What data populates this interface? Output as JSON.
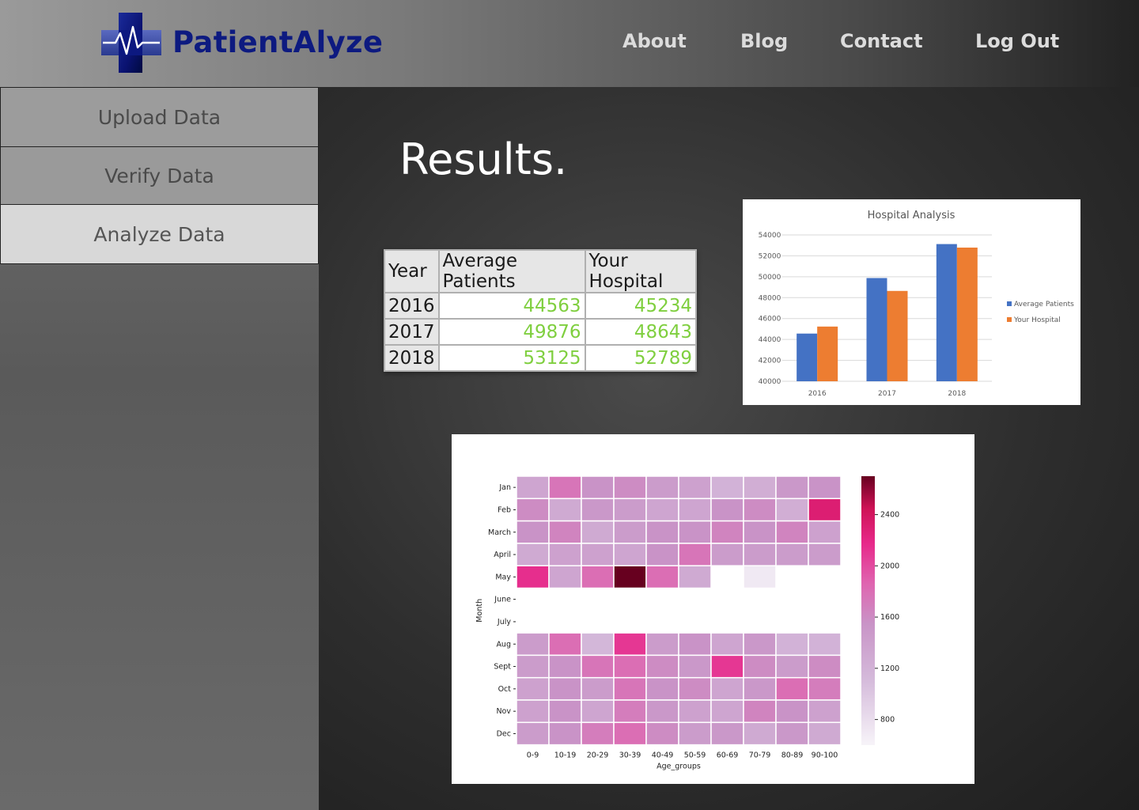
{
  "header": {
    "brand": "PatientAlyze",
    "nav": [
      {
        "label": "About"
      },
      {
        "label": "Blog"
      },
      {
        "label": "Contact"
      },
      {
        "label": "Log Out"
      }
    ]
  },
  "sidebar": {
    "items": [
      {
        "label": "Upload Data"
      },
      {
        "label": "Verify Data"
      },
      {
        "label": "Analyze Data",
        "active": true
      }
    ]
  },
  "main": {
    "title": "Results."
  },
  "table": {
    "headers": [
      "Year",
      "Average Patients",
      "Your Hospital"
    ],
    "rows": [
      {
        "year": "2016",
        "average": "44563",
        "hospital": "45234"
      },
      {
        "year": "2017",
        "average": "49876",
        "hospital": "48643"
      },
      {
        "year": "2018",
        "average": "53125",
        "hospital": "52789"
      }
    ]
  },
  "chart_data": [
    {
      "type": "bar",
      "title": "Hospital Analysis",
      "categories": [
        "2016",
        "2017",
        "2018"
      ],
      "series": [
        {
          "name": "Average Patients",
          "values": [
            44563,
            49876,
            53125
          ],
          "color": "#4472c4"
        },
        {
          "name": "Your Hospital",
          "values": [
            45234,
            48643,
            52789
          ],
          "color": "#ed7d31"
        }
      ],
      "ylim": [
        40000,
        54000
      ],
      "yticks": [
        40000,
        42000,
        44000,
        46000,
        48000,
        50000,
        52000,
        54000
      ],
      "grid": true,
      "legend": "right"
    },
    {
      "type": "heatmap",
      "xlabel": "Age_groups",
      "ylabel": "Month",
      "x": [
        "0-9",
        "10-19",
        "20-29",
        "30-39",
        "40-49",
        "50-59",
        "60-69",
        "70-79",
        "80-89",
        "90-100"
      ],
      "y": [
        "Jan",
        "Feb",
        "March",
        "April",
        "May",
        "June",
        "July",
        "Aug",
        "Sept",
        "Oct",
        "Nov",
        "Dec"
      ],
      "values": [
        [
          1350,
          1750,
          1550,
          1600,
          1450,
          1400,
          1200,
          1250,
          1500,
          1550
        ],
        [
          1600,
          1300,
          1500,
          1450,
          1350,
          1350,
          1550,
          1600,
          1250,
          2300
        ],
        [
          1550,
          1650,
          1300,
          1450,
          1550,
          1550,
          1650,
          1550,
          1650,
          1400
        ],
        [
          1300,
          1400,
          1400,
          1350,
          1550,
          1750,
          1450,
          1450,
          1450,
          1450
        ],
        [
          2150,
          1350,
          1800,
          2700,
          1800,
          1300,
          null,
          700,
          null,
          null
        ],
        [
          null,
          null,
          null,
          null,
          null,
          null,
          null,
          null,
          null,
          null
        ],
        [
          null,
          null,
          null,
          null,
          null,
          null,
          null,
          null,
          null,
          null
        ],
        [
          1450,
          1800,
          1150,
          2100,
          1450,
          1550,
          1350,
          1500,
          1200,
          1200
        ],
        [
          1450,
          1550,
          1750,
          1800,
          1600,
          1500,
          2100,
          1600,
          1450,
          1600
        ],
        [
          1400,
          1550,
          1450,
          1750,
          1550,
          1600,
          1350,
          1500,
          1800,
          1700
        ],
        [
          1400,
          1550,
          1350,
          1700,
          1500,
          1400,
          1350,
          1650,
          1550,
          1400
        ],
        [
          1450,
          1550,
          1700,
          1800,
          1600,
          1450,
          1500,
          1300,
          1500,
          1300
        ]
      ],
      "colorbar_ticks": [
        800,
        1200,
        1600,
        2000,
        2400
      ],
      "vmin": 600,
      "vmax": 2700,
      "colormap": "PuRd"
    }
  ]
}
